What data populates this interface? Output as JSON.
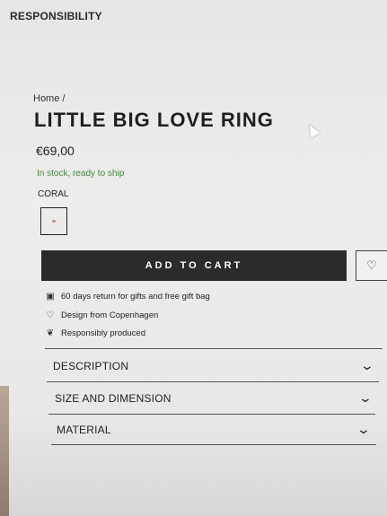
{
  "header": {
    "nav_label": "RESPONSIBILITY"
  },
  "breadcrumb": {
    "home": "Home /"
  },
  "product": {
    "title": "LITTLE BIG LOVE RING",
    "price": "€69,00",
    "stock": "In stock, ready to ship",
    "color_label": "CORAL",
    "swatch_color": "#c98a85"
  },
  "actions": {
    "add_to_cart": "ADD TO CART",
    "wishlist_icon": "heart-icon"
  },
  "features": [
    {
      "icon": "gift-icon",
      "text": "60 days return for gifts and free gift bag"
    },
    {
      "icon": "heart-icon",
      "text": "Design from Copenhagen"
    },
    {
      "icon": "leaf-icon",
      "text": "Responsibly produced"
    }
  ],
  "accordion": [
    {
      "label": "DESCRIPTION"
    },
    {
      "label": "SIZE AND DIMENSION"
    },
    {
      "label": "MATERIAL"
    }
  ],
  "colors": {
    "stock_green": "#3f8a3f",
    "button_dark": "#2b2b2b"
  }
}
